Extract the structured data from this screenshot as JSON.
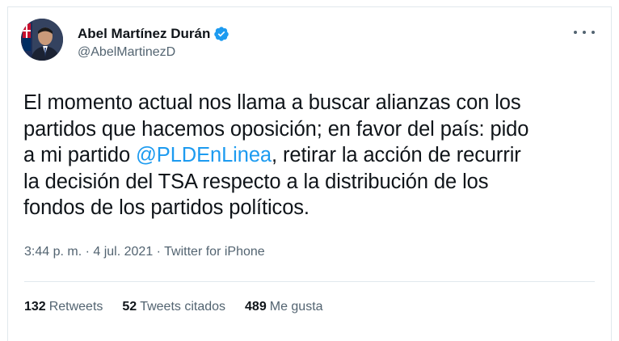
{
  "author": {
    "name": "Abel Martínez Durán",
    "handle": "@AbelMartinezD",
    "verified": true
  },
  "tweet": {
    "lines": [
      {
        "before": "El momento actual nos llama a buscar alianzas con los",
        "mention": "",
        "after": ""
      },
      {
        "before": "partidos que hacemos oposición; en favor del país: pido",
        "mention": "",
        "after": ""
      },
      {
        "before": "a mi partido ",
        "mention": "@PLDEnLinea",
        "after": ", retirar la acción de recurrir"
      },
      {
        "before": "la decisión del TSA respecto a la distribución de los",
        "mention": "",
        "after": ""
      },
      {
        "before": "fondos de los partidos políticos.",
        "mention": "",
        "after": ""
      }
    ]
  },
  "meta": {
    "time": "3:44 p. m.",
    "separator1": " · ",
    "date": "4 jul. 2021",
    "separator2": " · ",
    "source": "Twitter for iPhone"
  },
  "stats": {
    "retweets": {
      "count": "132",
      "label": "Retweets"
    },
    "quotes": {
      "count": "52",
      "label": "Tweets citados"
    },
    "likes": {
      "count": "489",
      "label": "Me gusta"
    }
  },
  "colors": {
    "link": "#1d9bf0",
    "secondary_text": "#536471",
    "primary_text": "#0f1419",
    "border": "#e1e8ed"
  },
  "icons": {
    "verified": "verified-badge-icon",
    "more": "more-options-icon"
  }
}
